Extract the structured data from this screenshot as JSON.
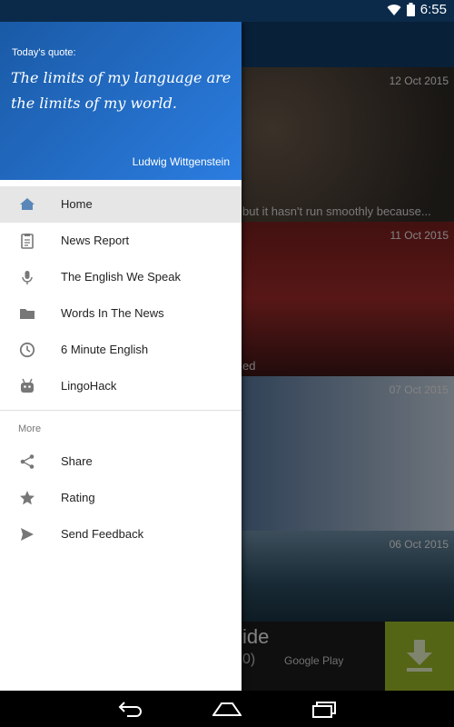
{
  "status_bar": {
    "time": "6:55",
    "icons": [
      "wifi-icon",
      "battery-icon"
    ]
  },
  "drawer": {
    "quote": {
      "label": "Today's quote:",
      "text": "The limits of my language are the limits of my world.",
      "author": "Ludwig Wittgenstein"
    },
    "items": [
      {
        "label": "Home",
        "icon": "home-icon",
        "active": true
      },
      {
        "label": "News Report",
        "icon": "clipboard-icon"
      },
      {
        "label": "The English We Speak",
        "icon": "microphone-icon"
      },
      {
        "label": "Words In The News",
        "icon": "folder-icon"
      },
      {
        "label": "6 Minute English",
        "icon": "clock-icon"
      },
      {
        "label": "LingoHack",
        "icon": "android-icon"
      }
    ],
    "more_label": "More",
    "more_items": [
      {
        "label": "Share",
        "icon": "share-icon"
      },
      {
        "label": "Rating",
        "icon": "star-icon"
      },
      {
        "label": "Send Feedback",
        "icon": "send-icon"
      }
    ]
  },
  "background": {
    "cards": [
      {
        "date": "12 Oct 2015",
        "caption": "but it hasn't run smoothly because..."
      },
      {
        "date": "11 Oct 2015",
        "caption": "ed"
      },
      {
        "date": "07 Oct 2015",
        "caption": ""
      },
      {
        "date": "06 Oct 2015",
        "caption": ""
      }
    ],
    "ad": {
      "title": "ide",
      "count": "0)",
      "store": "Google Play"
    }
  },
  "nav_bar": {
    "buttons": [
      "back-icon",
      "home-button-icon",
      "recents-icon"
    ]
  },
  "colors": {
    "drawer_header": "#1f6bc6",
    "toolbar": "#0f3b66",
    "ad_download": "#9bb928"
  }
}
